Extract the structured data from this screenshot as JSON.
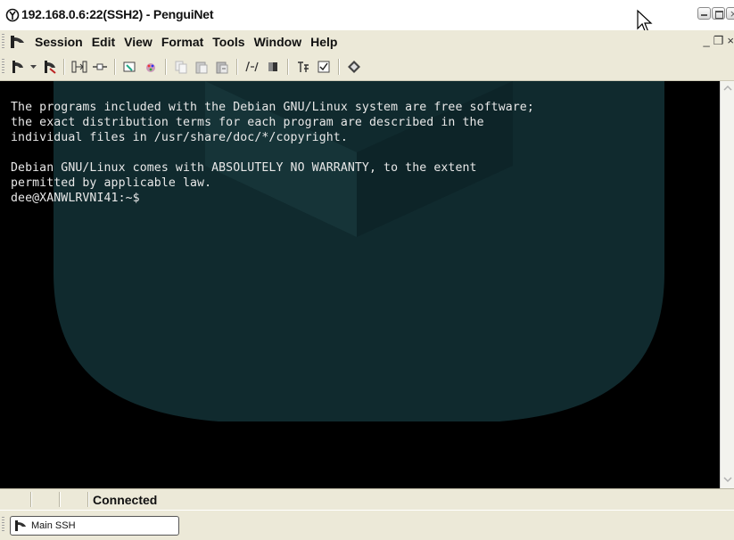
{
  "window": {
    "title": "192.168.0.6:22(SSH2) - PenguiNet",
    "controls": [
      "minimize",
      "maximize",
      "close"
    ]
  },
  "menu": {
    "items": [
      "Session",
      "Edit",
      "View",
      "Format",
      "Tools",
      "Window",
      "Help"
    ],
    "mdi_controls": [
      "_",
      "❐",
      "×"
    ]
  },
  "toolbar": {
    "icons": [
      "connect-icon",
      "dropdown-arrow-icon",
      "disconnect-icon",
      "sftp-icon",
      "port-forward-icon",
      "keygen-icon",
      "paint-icon",
      "copy-icon",
      "paste-icon",
      "paste-special-icon",
      "font-icon",
      "color-icon",
      "scripts-icon",
      "checklist-icon",
      "help-book-icon"
    ]
  },
  "terminal": {
    "lines": [
      "The programs included with the Debian GNU/Linux system are free software;",
      "the exact distribution terms for each program are described in the",
      "individual files in /usr/share/doc/*/copyright.",
      "",
      "Debian GNU/Linux comes with ABSOLUTELY NO WARRANTY, to the extent",
      "permitted by applicable law.",
      "dee@XANWLRVNI41:~$"
    ],
    "colors": {
      "background": "#000000",
      "foreground": "#e8e8e8",
      "watermark": "#102a2e"
    }
  },
  "status": {
    "text": "Connected"
  },
  "taskbar": {
    "button_label": "Main SSH"
  }
}
